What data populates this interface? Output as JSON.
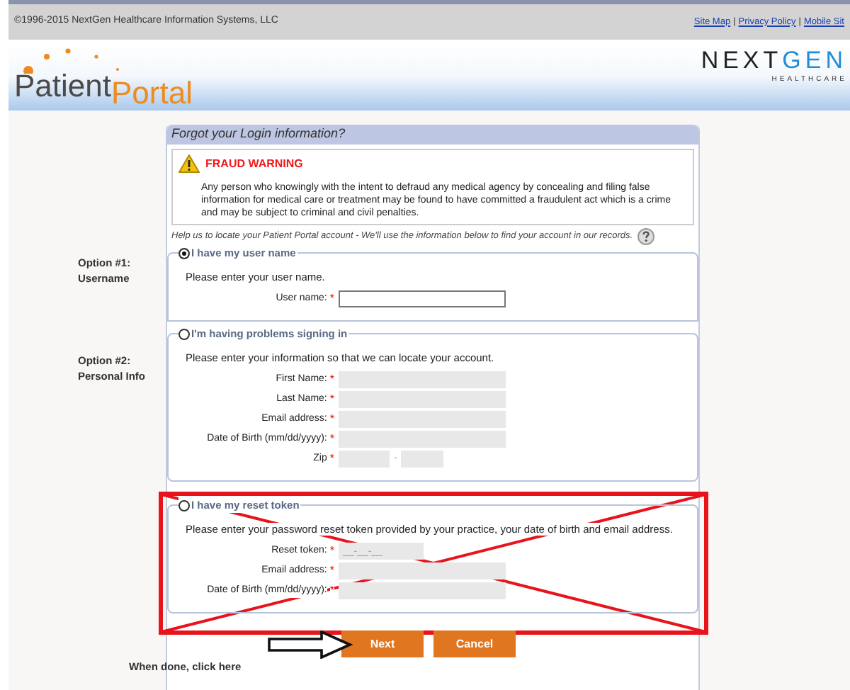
{
  "top_bar": {
    "copyright": "©1996-2015 NextGen Healthcare Information Systems, LLC",
    "links": [
      "Site Map",
      "Privacy Policy",
      "Mobile Sit"
    ],
    "separator": "|"
  },
  "header": {
    "logo_first": "Patient",
    "logo_second": "Portal",
    "brand_first": "NEXT",
    "brand_second": "GEN",
    "brand_sub": "HEALTHCARE"
  },
  "form": {
    "title": "Forgot your Login information?",
    "required_mark": "*",
    "warning": {
      "title": "FRAUD WARNING",
      "text": "Any person who knowingly with the intent to defraud any medical agency by concealing and filing false information for medical care or treatment may be found to have committed a fraudulent act which is a crime and may be subject to criminal and civil penalties."
    },
    "help": "Help us to locate your Patient Portal account - We'll use the information below to find your account in our records.",
    "options": [
      {
        "side_label": [
          "Option #1:",
          "Username"
        ],
        "label": "I have my user name",
        "selected": true,
        "crossed_out": false,
        "description": "Please enter your user name.",
        "fields": [
          {
            "kind": "text",
            "label": "User name:",
            "required": true,
            "disabled": false
          }
        ]
      },
      {
        "side_label": [
          "Option #2:",
          "Personal Info"
        ],
        "label": "I'm having problems signing in",
        "selected": false,
        "crossed_out": false,
        "description": "Please enter your information so that we can locate your account.",
        "fields": [
          {
            "kind": "text",
            "label": "First Name:",
            "required": true,
            "disabled": true
          },
          {
            "kind": "text",
            "label": "Last Name:",
            "required": true,
            "disabled": true
          },
          {
            "kind": "text",
            "label": "Email address:",
            "required": true,
            "disabled": true
          },
          {
            "kind": "text",
            "label": "Date of Birth (mm/dd/yyyy):",
            "required": true,
            "disabled": true
          },
          {
            "kind": "zip",
            "label": "Zip",
            "separator": "-",
            "required": true,
            "disabled": true
          }
        ]
      },
      {
        "label": "I have my reset token",
        "selected": false,
        "crossed_out": true,
        "description": "Please enter your password reset token provided by your practice, your date of birth and email address.",
        "fields": [
          {
            "kind": "token",
            "label": "Reset token:",
            "placeholder": "__-__-__",
            "required": true,
            "disabled": true
          },
          {
            "kind": "text",
            "label": "Email address:",
            "required": true,
            "disabled": true
          },
          {
            "kind": "text",
            "label": "Date of Birth (mm/dd/yyyy):",
            "required": true,
            "disabled": true
          }
        ]
      }
    ],
    "hint": "When done, click here",
    "buttons": [
      "Next",
      "Cancel"
    ]
  }
}
